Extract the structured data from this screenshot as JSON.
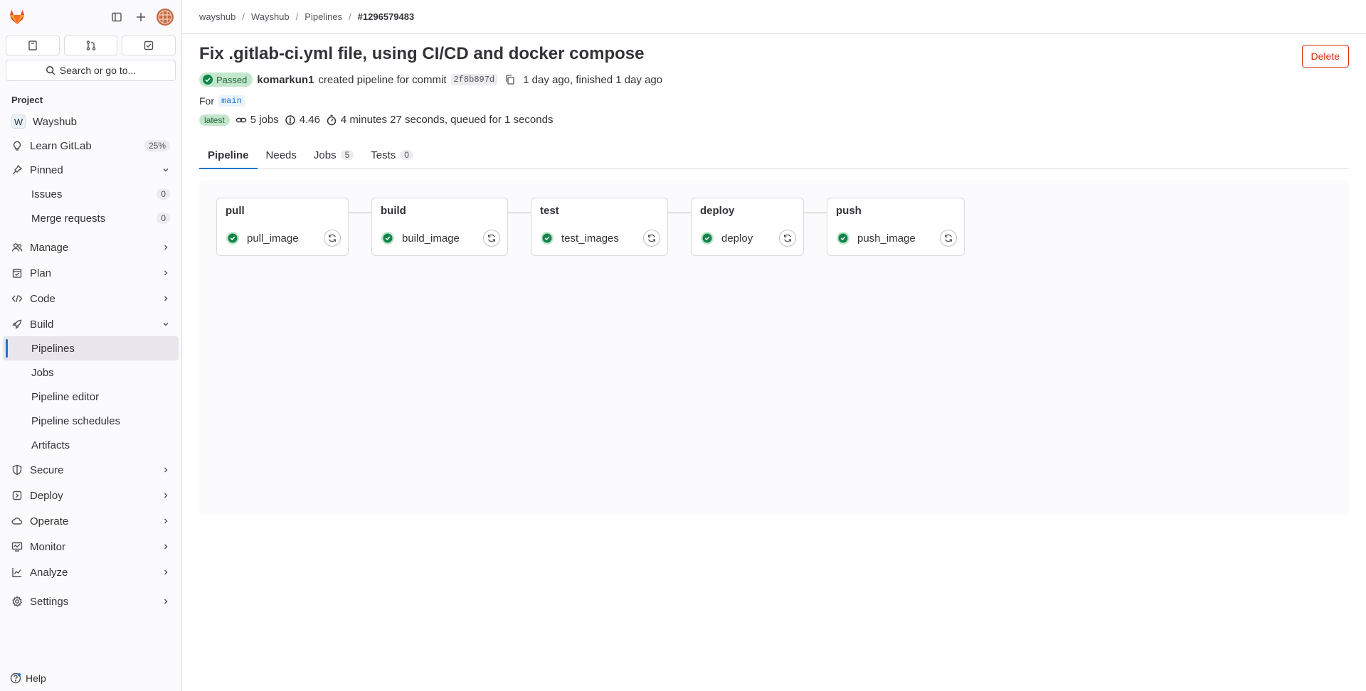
{
  "sidebar": {
    "section_title": "Project",
    "search_placeholder": "Search or go to...",
    "items": [
      {
        "name": "project-wayshub",
        "label": "Wayshub",
        "avatar": "W"
      },
      {
        "name": "learn-gitlab",
        "label": "Learn GitLab",
        "badge": "25%"
      },
      {
        "name": "pinned",
        "label": "Pinned"
      },
      {
        "name": "manage",
        "label": "Manage"
      },
      {
        "name": "plan",
        "label": "Plan"
      },
      {
        "name": "code",
        "label": "Code"
      },
      {
        "name": "build",
        "label": "Build"
      },
      {
        "name": "secure",
        "label": "Secure"
      },
      {
        "name": "deploy",
        "label": "Deploy"
      },
      {
        "name": "operate",
        "label": "Operate"
      },
      {
        "name": "monitor",
        "label": "Monitor"
      },
      {
        "name": "analyze",
        "label": "Analyze"
      },
      {
        "name": "settings",
        "label": "Settings"
      }
    ],
    "pinned_items": [
      {
        "label": "Issues",
        "badge": "0"
      },
      {
        "label": "Merge requests",
        "badge": "0"
      }
    ],
    "build_items": [
      {
        "label": "Pipelines"
      },
      {
        "label": "Jobs"
      },
      {
        "label": "Pipeline editor"
      },
      {
        "label": "Pipeline schedules"
      },
      {
        "label": "Artifacts"
      }
    ],
    "help": "Help"
  },
  "breadcrumb": [
    "wayshub",
    "Wayshub",
    "Pipelines",
    "#1296579483"
  ],
  "pipeline": {
    "title": "Fix .gitlab-ci.yml file, using CI/CD and docker compose",
    "delete_label": "Delete",
    "status": "Passed",
    "author": "komarkun1",
    "created_text": "created pipeline for commit",
    "sha": "2f8b897d",
    "time_text": "1 day ago, finished 1 day ago",
    "for_label": "For",
    "ref": "main",
    "latest_label": "latest",
    "jobs_count": "5 jobs",
    "compute": "4.46",
    "duration": "4 minutes 27 seconds, queued for 1 seconds"
  },
  "tabs": [
    {
      "label": "Pipeline"
    },
    {
      "label": "Needs"
    },
    {
      "label": "Jobs",
      "count": "5"
    },
    {
      "label": "Tests",
      "count": "0"
    }
  ],
  "stages": [
    {
      "name": "pull",
      "job": "pull_image"
    },
    {
      "name": "build",
      "job": "build_image"
    },
    {
      "name": "test",
      "job": "test_images"
    },
    {
      "name": "deploy",
      "job": "deploy"
    },
    {
      "name": "push",
      "job": "push_image"
    }
  ],
  "colors": {
    "accent": "#1f75cb",
    "success": "#108548",
    "danger": "#dd2b0e",
    "brand": "#e24329"
  }
}
